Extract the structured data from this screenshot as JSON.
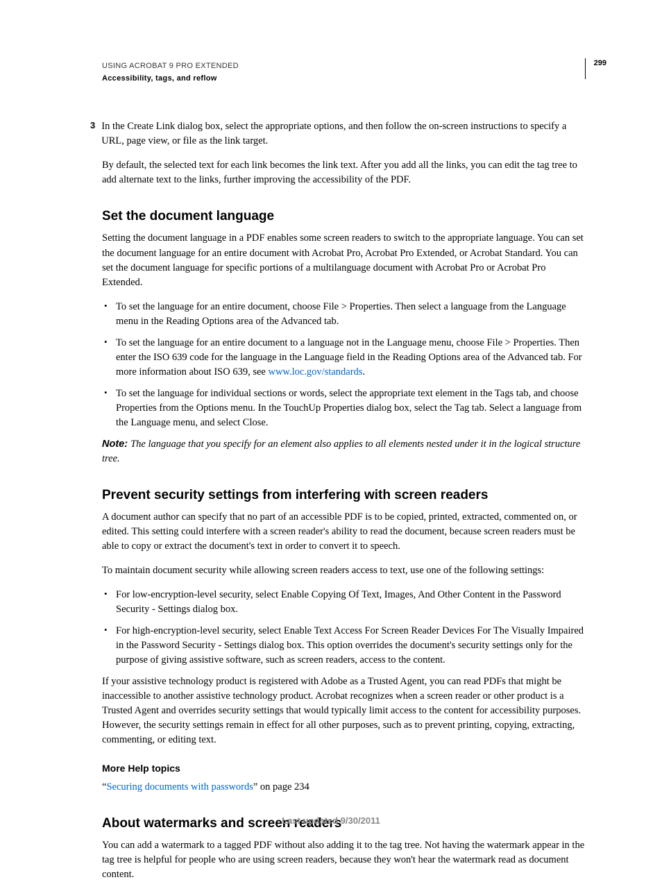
{
  "header": {
    "doc_title": "USING ACROBAT 9 PRO EXTENDED",
    "section": "Accessibility, tags, and reflow",
    "page_number": "299"
  },
  "step3": {
    "num": "3",
    "text": "In the Create Link dialog box, select the appropriate options, and then follow the on-screen instructions to specify a URL, page view, or file as the link target."
  },
  "para_default": "By default, the selected text for each link becomes the link text. After you add all the links, you can edit the tag tree to add alternate text to the links, further improving the accessibility of the PDF.",
  "heading_lang": "Set the document language",
  "para_lang_intro": "Setting the document language in a PDF enables some screen readers to switch to the appropriate language. You can set the document language for an entire document with Acrobat Pro, Acrobat Pro Extended, or Acrobat Standard. You can set the document language for specific portions of a multilanguage document with Acrobat Pro or Acrobat Pro Extended.",
  "lang_bullets": {
    "b1": "To set the language for an entire document, choose File > Properties. Then select a language from the Language menu in the Reading Options area of the Advanced tab.",
    "b2_pre": "To set the language for an entire document to a language not in the Language menu, choose File > Properties. Then enter the ISO 639 code for the language in the Language field in the Reading Options area of the Advanced tab. For more information about ISO 639, see ",
    "b2_link": "www.loc.gov/standards",
    "b2_post": ".",
    "b3": "To set the language for individual sections or words, select the appropriate text element in the Tags tab, and choose Properties from the Options menu. In the TouchUp Properties dialog box, select the Tag tab. Select a language from the Language menu, and select Close."
  },
  "note": {
    "label": "Note: ",
    "text": "The language that you specify for an element also applies to all elements nested under it in the logical structure tree."
  },
  "heading_security": "Prevent security settings from interfering with screen readers",
  "para_sec1": "A document author can specify that no part of an accessible PDF is to be copied, printed, extracted, commented on, or edited. This setting could interfere with a screen reader's ability to read the document, because screen readers must be able to copy or extract the document's text in order to convert it to speech.",
  "para_sec2": "To maintain document security while allowing screen readers access to text, use one of the following settings:",
  "sec_bullets": {
    "b1": "For low-encryption-level security, select Enable Copying Of Text, Images, And Other Content in the Password Security - Settings dialog box.",
    "b2": "For high-encryption-level security, select Enable Text Access For Screen Reader Devices For The Visually Impaired in the Password Security - Settings dialog box. This option overrides the document's security settings only for the purpose of giving assistive software, such as screen readers, access to the content."
  },
  "para_sec3": "If your assistive technology product is registered with Adobe as a Trusted Agent, you can read PDFs that might be inaccessible to another assistive technology product. Acrobat recognizes when a screen reader or other product is a Trusted Agent and overrides security settings that would typically limit access to the content for accessibility purposes. However, the security settings remain in effect for all other purposes, such as to prevent printing, copying, extracting, commenting, or editing text.",
  "more_help": {
    "heading": "More Help topics",
    "quote_open": "“",
    "link": "Securing documents with passwords",
    "quote_close_text": "” on page 234"
  },
  "heading_watermark": "About watermarks and screen readers",
  "para_watermark": "You can add a watermark to a tagged PDF without also adding it to the tag tree. Not having the watermark appear in the tag tree is helpful for people who are using screen readers, because they won't hear the watermark read as document content.",
  "footer": "Last updated 9/30/2011"
}
